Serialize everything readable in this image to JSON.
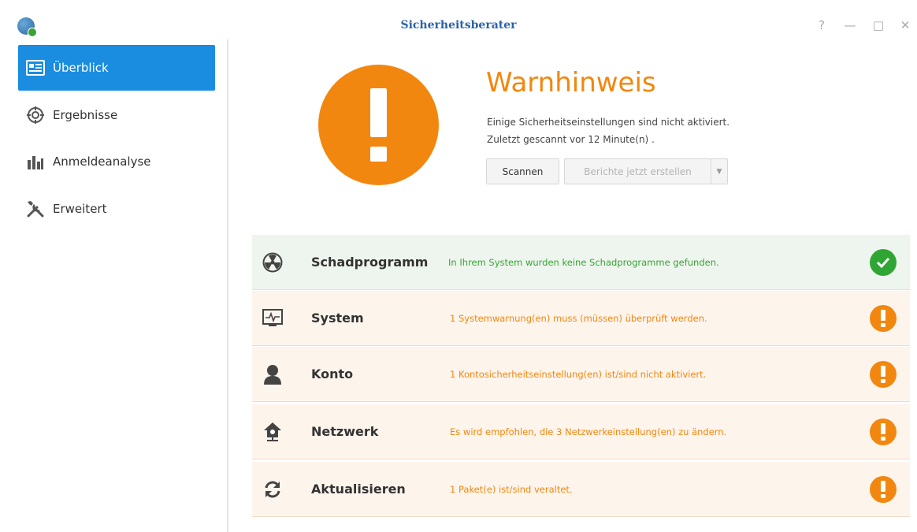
{
  "window": {
    "title": "Sicherheitsberater",
    "controls": {
      "help": "?",
      "minimize": "—",
      "maximize": "□",
      "close": "✕"
    }
  },
  "sidebar": {
    "items": [
      {
        "label": "Überblick",
        "icon": "overview-icon",
        "active": true
      },
      {
        "label": "Ergebnisse",
        "icon": "target-icon",
        "active": false
      },
      {
        "label": "Anmeldeanalyse",
        "icon": "bar-chart-icon",
        "active": false
      },
      {
        "label": "Erweitert",
        "icon": "tools-icon",
        "active": false
      }
    ]
  },
  "overview": {
    "status_title": "Warnhinweis",
    "description": "Einige Sicherheitseinstellungen sind nicht aktiviert.",
    "last_scan": "Zuletzt gescannt vor 12 Minute(n) .",
    "scan_button": "Scannen",
    "report_button": "Berichte jetzt erstellen",
    "dropdown_glyph": "▼"
  },
  "results": [
    {
      "name": "Schadprogramm",
      "icon": "radiation-icon",
      "message": "In Ihrem System wurden keine Schadprogramme gefunden.",
      "status": "ok"
    },
    {
      "name": "System",
      "icon": "monitor-pulse-icon",
      "message": "1 Systemwarnung(en) muss (müssen) überprüft werden.",
      "status": "warn"
    },
    {
      "name": "Konto",
      "icon": "user-icon",
      "message": "1 Kontosicherheitseinstellung(en) ist/sind nicht aktiviert.",
      "status": "warn"
    },
    {
      "name": "Netzwerk",
      "icon": "home-network-icon",
      "message": "Es wird empfohlen, die 3 Netzwerkeinstellung(en) zu ändern.",
      "status": "warn"
    },
    {
      "name": "Aktualisieren",
      "icon": "refresh-icon",
      "message": "1 Paket(e) ist/sind veraltet.",
      "status": "warn"
    }
  ],
  "colors": {
    "accent": "#1a8de0",
    "warning": "#f2870f",
    "ok": "#2fa634",
    "title": "#2b62a7"
  }
}
